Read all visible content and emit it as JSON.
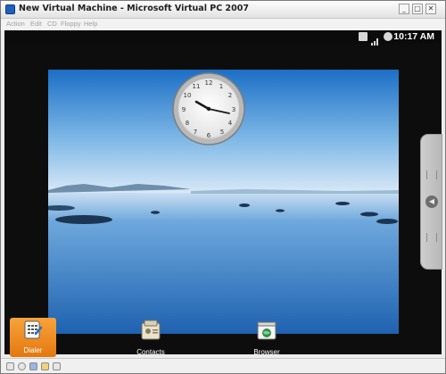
{
  "window": {
    "title": "New Virtual Machine - Microsoft Virtual PC 2007",
    "controls": {
      "minimize": "_",
      "maximize": "□",
      "close": "✕"
    }
  },
  "menu": {
    "items": [
      "Action",
      "Edit",
      "CD",
      "Floppy",
      "Help"
    ]
  },
  "android": {
    "status_time": "10:17 AM",
    "status_icons": [
      "network-icon",
      "signal-icon",
      "help-icon"
    ],
    "wallpaper_theme": "lake-sky",
    "clock_widget": {
      "hour": 10,
      "minute": 17
    },
    "dock": [
      {
        "label": "Dialer",
        "icon": "dialer-icon",
        "selected": true
      },
      {
        "label": "Contacts",
        "icon": "contacts-icon",
        "selected": false
      },
      {
        "label": "Browser",
        "icon": "browser-icon",
        "selected": false
      }
    ],
    "drawer_handle_icon": "chevron-left-icon"
  },
  "toolbar": {
    "icons": [
      "device-icon",
      "disc-icon",
      "floppy-icon",
      "folder-icon",
      "usb-icon"
    ]
  },
  "colors": {
    "accent_orange": "#f08c1e",
    "sky_top": "#1c6fc6",
    "sky_horizon": "#dbeaf7",
    "water": "#2b74c2"
  }
}
